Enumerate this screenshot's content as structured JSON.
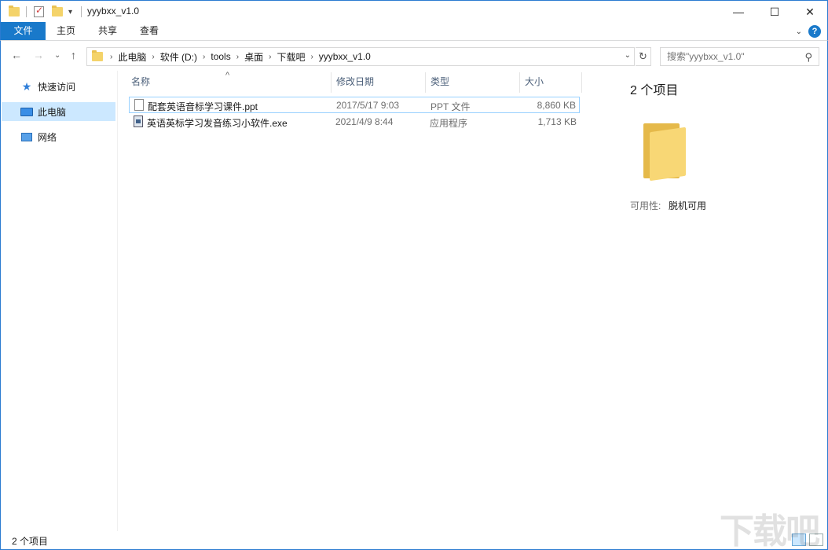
{
  "window": {
    "title": "yyybxx_v1.0"
  },
  "ribbon": {
    "tabs": [
      "文件",
      "主页",
      "共享",
      "查看"
    ]
  },
  "address": {
    "crumbs": [
      "此电脑",
      "软件 (D:)",
      "tools",
      "桌面",
      "下载吧",
      "yyybxx_v1.0"
    ]
  },
  "search": {
    "placeholder": "搜索\"yyybxx_v1.0\""
  },
  "sidebar": {
    "items": [
      "快速访问",
      "此电脑",
      "网络"
    ]
  },
  "columns": {
    "name": "名称",
    "date": "修改日期",
    "type": "类型",
    "size": "大小"
  },
  "files": [
    {
      "name": "配套英语音标学习课件.ppt",
      "date": "2017/5/17 9:03",
      "type": "PPT 文件",
      "size": "8,860 KB",
      "icon": "ppt-file-icon"
    },
    {
      "name": "英语英标学习发音练习小软件.exe",
      "date": "2021/4/9 8:44",
      "type": "应用程序",
      "size": "1,713 KB",
      "icon": "exe-file-icon"
    }
  ],
  "details": {
    "count": "2 个项目",
    "availability_label": "可用性:",
    "availability_value": "脱机可用"
  },
  "status": {
    "text": "2 个项目"
  },
  "watermark": {
    "text": "下载吧"
  },
  "colors": {
    "accent": "#1979ca",
    "selection": "#cce8ff",
    "border": "#2b7bd1"
  }
}
